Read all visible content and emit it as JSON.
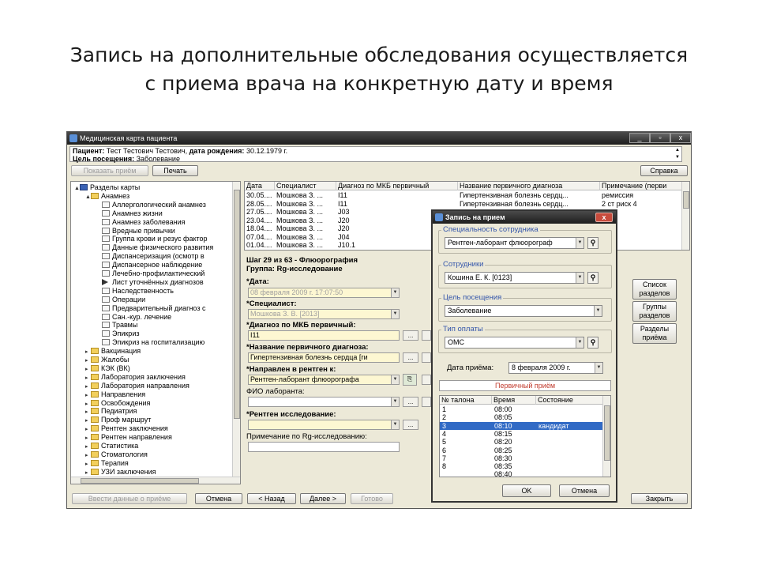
{
  "slide": {
    "title_line1": "Запись на дополнительные обследования осуществляется",
    "title_line2": "с приема врача на конкретную дату и время"
  },
  "window": {
    "title": "Медицинская карта пациента",
    "controls": [
      "_",
      "▫",
      "x"
    ]
  },
  "patient": {
    "label_patient": "Пациент:",
    "name": "Тест Тестович Тестович,",
    "label_dob": "дата рождения:",
    "dob": "30.12.1979 г.",
    "label_purpose": "Цель посещения:",
    "purpose": "Заболевание"
  },
  "toolbar": {
    "show_visit": "Показать приём",
    "print": "Печать",
    "help": "Справка"
  },
  "tree": {
    "items": [
      {
        "text": "Разделы карты",
        "icon": "book-icon",
        "level": 0,
        "exp": "▲"
      },
      {
        "text": "Анамнез",
        "icon": "folder-icon",
        "level": 1,
        "exp": "▲"
      },
      {
        "text": "Аллергологический анамнез",
        "icon": "document-icon",
        "level": 2,
        "exp": ""
      },
      {
        "text": "Анамнез жизни",
        "icon": "document-icon",
        "level": 2,
        "exp": ""
      },
      {
        "text": "Анамнез заболевания",
        "icon": "document-icon",
        "level": 2,
        "exp": ""
      },
      {
        "text": "Вредные привычки",
        "icon": "document-icon",
        "level": 2,
        "exp": ""
      },
      {
        "text": "Группа крови и резус фактор",
        "icon": "document-icon",
        "level": 2,
        "exp": ""
      },
      {
        "text": "Данные физического развития",
        "icon": "document-icon",
        "level": 2,
        "exp": ""
      },
      {
        "text": "Диспансеризация (осмотр в",
        "icon": "document-icon",
        "level": 2,
        "exp": ""
      },
      {
        "text": "Диспансерное наблюдение",
        "icon": "document-icon",
        "level": 2,
        "exp": ""
      },
      {
        "text": "Лечебно-профилактический",
        "icon": "document-icon",
        "level": 2,
        "exp": ""
      },
      {
        "text": "Лист уточнённых диагнозов",
        "icon": "arrow-icon",
        "level": 2,
        "exp": ""
      },
      {
        "text": "Наследственность",
        "icon": "document-icon",
        "level": 2,
        "exp": ""
      },
      {
        "text": "Операции",
        "icon": "document-icon",
        "level": 2,
        "exp": ""
      },
      {
        "text": "Предварительный диагноз с",
        "icon": "document-icon",
        "level": 2,
        "exp": ""
      },
      {
        "text": "Сан.-кур. лечение",
        "icon": "document-icon",
        "level": 2,
        "exp": ""
      },
      {
        "text": "Травмы",
        "icon": "document-icon",
        "level": 2,
        "exp": ""
      },
      {
        "text": "Эпикриз",
        "icon": "document-icon",
        "level": 2,
        "exp": ""
      },
      {
        "text": "Эпикриз на госпитализацию",
        "icon": "document-icon",
        "level": 2,
        "exp": ""
      },
      {
        "text": "Вакцинация",
        "icon": "folder-icon",
        "level": 1,
        "exp": "▸"
      },
      {
        "text": "Жалобы",
        "icon": "folder-icon",
        "level": 1,
        "exp": "▸"
      },
      {
        "text": "КЭК (ВК)",
        "icon": "folder-icon",
        "level": 1,
        "exp": "▸"
      },
      {
        "text": "Лаборатория заключения",
        "icon": "folder-icon",
        "level": 1,
        "exp": "▸"
      },
      {
        "text": "Лаборатория направления",
        "icon": "folder-icon",
        "level": 1,
        "exp": "▸"
      },
      {
        "text": "Направления",
        "icon": "folder-icon",
        "level": 1,
        "exp": "▸"
      },
      {
        "text": "Освобождения",
        "icon": "folder-icon",
        "level": 1,
        "exp": "▸"
      },
      {
        "text": "Педиатрия",
        "icon": "folder-icon",
        "level": 1,
        "exp": "▸"
      },
      {
        "text": "Проф маршрут",
        "icon": "folder-icon",
        "level": 1,
        "exp": "▸"
      },
      {
        "text": "Рентген заключения",
        "icon": "folder-icon",
        "level": 1,
        "exp": "▸"
      },
      {
        "text": "Рентген направления",
        "icon": "folder-icon",
        "level": 1,
        "exp": "▸"
      },
      {
        "text": "Статистика",
        "icon": "folder-icon",
        "level": 1,
        "exp": "▸"
      },
      {
        "text": "Стоматология",
        "icon": "folder-icon",
        "level": 1,
        "exp": "▸"
      },
      {
        "text": "Терапия",
        "icon": "folder-icon",
        "level": 1,
        "exp": "▸"
      },
      {
        "text": "УЗИ заключения",
        "icon": "folder-icon",
        "level": 1,
        "exp": "▸"
      }
    ]
  },
  "visits": {
    "columns": [
      "Дата",
      "Специалист",
      "Диагноз по МКБ первичный",
      "Название первичного диагноза",
      "Примечание (перви"
    ],
    "rows": [
      [
        "30.05....",
        "Мошкова З. ...",
        "I11",
        "Гипертензивная болезнь сердц...",
        "ремиссия"
      ],
      [
        "28.05....",
        "Мошкова З. ...",
        "I11",
        "Гипертензивная болезнь сердц...",
        "2 ст риск 4"
      ],
      [
        "27.05....",
        "Мошкова З. ...",
        "J03",
        "",
        ""
      ],
      [
        "23.04....",
        "Мошкова З. ...",
        "J20",
        "",
        ""
      ],
      [
        "18.04....",
        "Мошкова З. ...",
        "J20",
        "",
        ""
      ],
      [
        "07.04....",
        "Мошкова З. ...",
        "J04",
        "",
        ""
      ],
      [
        "01.04....",
        "Мошкова З. ...",
        "J10.1",
        "",
        ""
      ]
    ]
  },
  "step": {
    "header": "Шаг 29 из 63 - Флюорография",
    "group": "Группа: Rg-исследование",
    "date_label": "*Дата:",
    "date_value": "08 февраля 2009 г.   17:07:50",
    "specialist_label": "*Специалист:",
    "specialist_value": "Мошкова З. В.  [2013]",
    "mkb_label": "*Диагноз по МКБ первичный:",
    "mkb_value": "I11",
    "diag_label": "*Название первичного диагноза:",
    "diag_value": "Гипертензивная болезнь сердца [ги",
    "xray_label": "*Направлен в рентген к:",
    "xray_value": "Рентген-лаборант флюорографа",
    "lab_label": "ФИО лаборанта:",
    "lab_value": "",
    "study_label": "*Рентген исследование:",
    "study_value": "",
    "note_label": "Примечание по Rg-исследованию:",
    "note_value": "",
    "dots": "..."
  },
  "side_buttons": {
    "list_sections": "Список\nразделов",
    "groups_sections": "Группы\nразделов",
    "visit_sections": "Разделы\nприёма"
  },
  "bottom": {
    "enter_data": "Ввести данные о приёме",
    "cancel": "Отмена",
    "back": "< Назад",
    "next": "Далее >",
    "done": "Готово",
    "close": "Закрыть"
  },
  "modal": {
    "title": "Запись на прием",
    "close": "x",
    "spec_label": "Специальность сотрудника",
    "spec_value": "Рентген-лаборант флюорограф",
    "staff_label": "Сотрудники",
    "staff_value": "Кошина Е. К.  [0123]",
    "purpose_label": "Цель посещения",
    "purpose_value": "Заболевание",
    "pay_label": "Тип оплаты",
    "pay_value": "ОМС",
    "date_label": "Дата приёма:",
    "date_value": "8 февраля 2009 г.",
    "reception_type": "Первичный приём",
    "slot_columns": [
      "№ талона",
      "Время",
      "Состояние"
    ],
    "slots": [
      {
        "no": "1",
        "time": "08:00",
        "state": ""
      },
      {
        "no": "2",
        "time": "08:05",
        "state": ""
      },
      {
        "no": "3",
        "time": "08:10",
        "state": "кандидат"
      },
      {
        "no": "4",
        "time": "08:15",
        "state": ""
      },
      {
        "no": "5",
        "time": "08:20",
        "state": ""
      },
      {
        "no": "6",
        "time": "08:25",
        "state": ""
      },
      {
        "no": "7",
        "time": "08:30",
        "state": ""
      },
      {
        "no": "8",
        "time": "08:35",
        "state": ""
      },
      {
        "no": "",
        "time": "08:40",
        "state": ""
      }
    ],
    "selected_slot": 2,
    "ok": "OK",
    "cancel": "Отмена"
  },
  "colors": {
    "selection": "#316ac5",
    "required_field": "#fdf7d2",
    "reception_type_text": "#c0392b",
    "group_label": "#3355aa"
  }
}
